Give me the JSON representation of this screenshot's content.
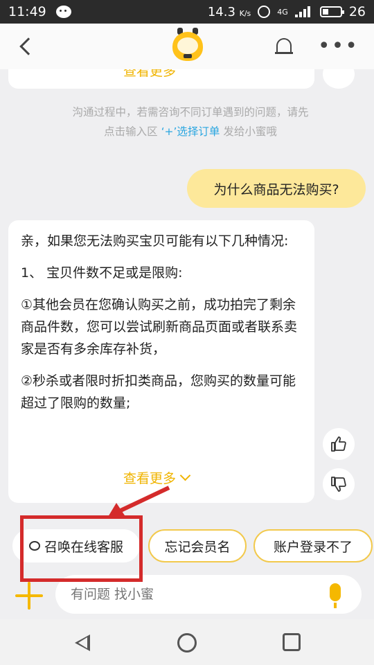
{
  "status_bar": {
    "time": "11:49",
    "speed_value": "14.3",
    "speed_unit": "K/s",
    "network": "4G",
    "battery": "26"
  },
  "nav": {
    "title": "",
    "back": "back",
    "bell": "bell",
    "more": "•••"
  },
  "top_card": {
    "see_more": "查看更多"
  },
  "system_tip": {
    "text_pre": "沟通过程中，若需咨询不同订单遇到的问题，请先点击输入区 ",
    "link_plus": "‘+’",
    "link_select": "选择订单",
    "text_post": " 发给小蜜哦"
  },
  "user_message": {
    "text": "为什么商品无法购买?"
  },
  "bot_message": {
    "p1": "亲，如果您无法购买宝贝可能有以下几种情况:",
    "p2": "1、 宝贝件数不足或是限购:",
    "p3": "①其他会员在您确认购买之前，成功拍完了剩余商品件数，您可以尝试刷新商品页面或者联系卖家是否有多余库存补货，",
    "p4": "②秒杀或者限时折扣类商品，您购买的数量可能超过了限购的数量;",
    "see_more": "查看更多"
  },
  "quick_replies": [
    {
      "label": "召唤在线客服"
    },
    {
      "label": "忘记会员名"
    },
    {
      "label": "账户登录不了"
    }
  ],
  "input": {
    "placeholder": "有问题 找小蜜"
  },
  "colors": {
    "accent": "#f5b800",
    "user_bubble": "#fde89a",
    "annotation": "#d42b2b",
    "link": "#2aa6e0"
  }
}
